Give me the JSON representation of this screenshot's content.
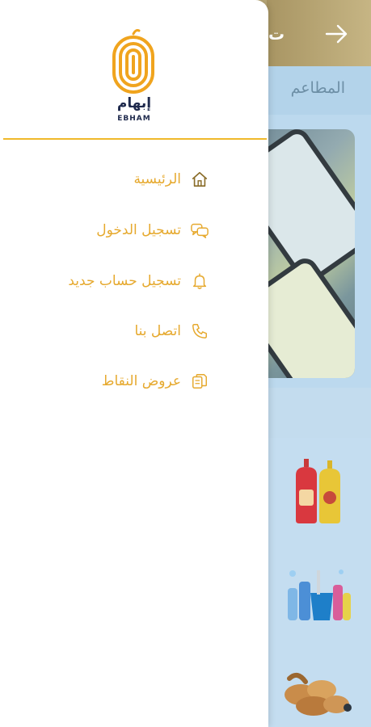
{
  "background": {
    "title_fragment": "ت",
    "tab_label": "المطاعم",
    "colors": {
      "topbar": "#b8a777",
      "content": "#bcd9ee"
    },
    "icons": [
      "arrow-right-icon",
      "sauce-bottles-icon",
      "cleaning-supplies-icon",
      "bread-icon"
    ]
  },
  "drawer": {
    "logo": {
      "arabic": "إبهام",
      "english": "EBHAM"
    },
    "accent_color": "#e6a92e",
    "divider_color": "#f0b92a",
    "menu": [
      {
        "label": "الرئيسية",
        "icon": "home-icon"
      },
      {
        "label": "تسجيل الدخول",
        "icon": "chat-bubbles-icon"
      },
      {
        "label": "تسجيل حساب جديد",
        "icon": "bell-icon"
      },
      {
        "label": "اتصل بنا",
        "icon": "phone-icon"
      },
      {
        "label": "عروض النقاط",
        "icon": "copy-document-icon"
      }
    ]
  }
}
